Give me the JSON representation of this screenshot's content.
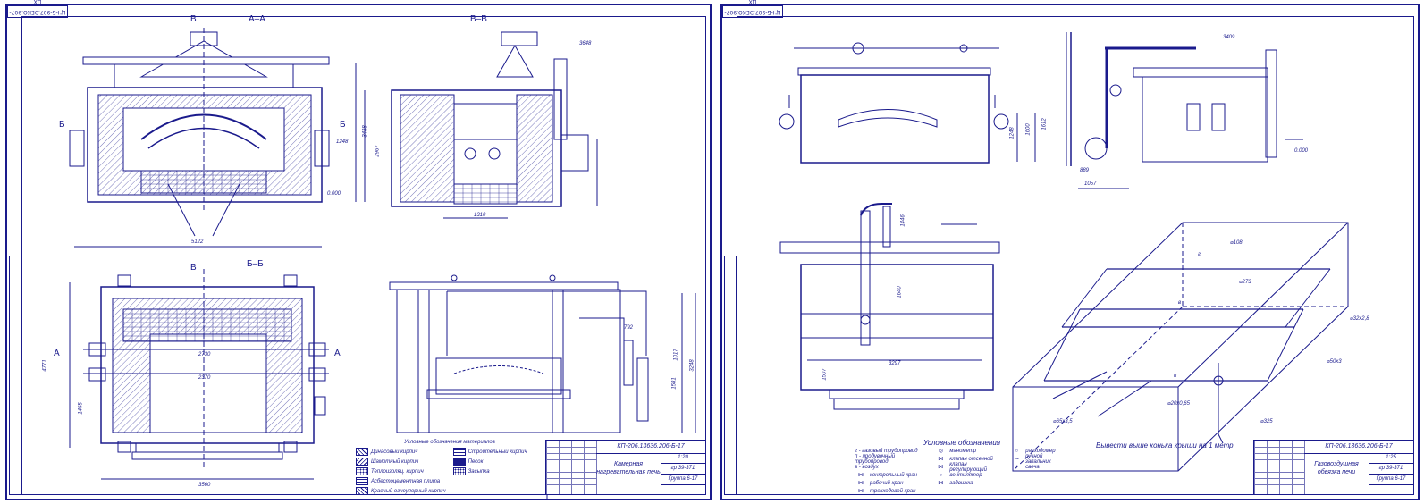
{
  "left_sheet": {
    "code_tag": "ЦЧ-Б-907.ЭЕКО.907-ЦХ",
    "sections": {
      "aa": "А–А",
      "vv": "В–В",
      "bb": "Б–Б",
      "mark_v_top": "В",
      "mark_v_bottom": "В",
      "mark_b_left": "Б",
      "mark_b_right": "Б",
      "mark_a_left": "А",
      "mark_a_right": "А"
    },
    "dimensions": {
      "d5122": "5122",
      "d3438": "3438",
      "d1248": "1248",
      "d2967": "2967",
      "d1310": "1310",
      "d3648": "3648",
      "d0000": "0.000",
      "d4771": "4771",
      "d2730": "2730",
      "d2370": "2370",
      "d1455": "1455",
      "d3560": "3560",
      "d792": "792",
      "d1581": "1581",
      "d3248": "3248",
      "d1017": "1017"
    },
    "legend": {
      "title": "Условные обозначения материалов",
      "items": [
        "Динасовый кирпич",
        "Шамотный кирпич",
        "Теплоизоляц. кирпич",
        "Асбестоцементная плита",
        "Красный огнеупорный кирпич",
        "Строительный кирпич",
        "Песок",
        "Засыпка"
      ]
    },
    "title_block": {
      "code": "КП-206.13636.206-Б-17",
      "name": "Камерная нагревательная печь",
      "scale": "1:20",
      "group_line1": "гр 39-371",
      "group_line2": "Группа 6-17"
    }
  },
  "right_sheet": {
    "code_tag": "ЦЧ-Б-907.ЭЕКО.907-ЦХ",
    "dimensions": {
      "d3409": "3409",
      "d0000": "0.000",
      "d889": "889",
      "d1057": "1057",
      "d1248": "1248",
      "d1600": "1600",
      "d1612": "1612",
      "d1446": "1446",
      "d3297": "3297",
      "d1640": "1640",
      "d1507": "1507"
    },
    "pipe_marks": {
      "p108": "⌀108",
      "p273": "⌀273",
      "p32": "⌀32х2,8",
      "p50": "⌀50х3",
      "p20": "⌀20х0,65",
      "p65": "⌀65х3,5",
      "p325": "⌀325",
      "g": "г",
      "v": "в",
      "p": "п"
    },
    "note": "Вывести выше конька крыши на 1 метр",
    "legend": {
      "title": "Условные обозначения",
      "left_items": [
        "г - газовый трубопровод",
        "п - продувочный трубопровод",
        "в - воздух",
        "контрольный кран",
        "рабочий кран",
        "трехходовой кран"
      ],
      "mid_items": [
        "манометр",
        "клапан отсечной",
        "клапан регулирующий",
        "вентилятор",
        "задвижка"
      ],
      "right_items": [
        "расходомер",
        "ручной запальник",
        "свеча"
      ]
    },
    "title_block": {
      "code": "КП-206.13636.206-Б-17",
      "name": "Газовоздушная обвязка печи",
      "scale": "1:25",
      "group_line1": "гр 39-371",
      "group_line2": "Группа 6-17"
    }
  },
  "colors": {
    "ink": "#1a1a8c",
    "paper": "#ffffff"
  }
}
